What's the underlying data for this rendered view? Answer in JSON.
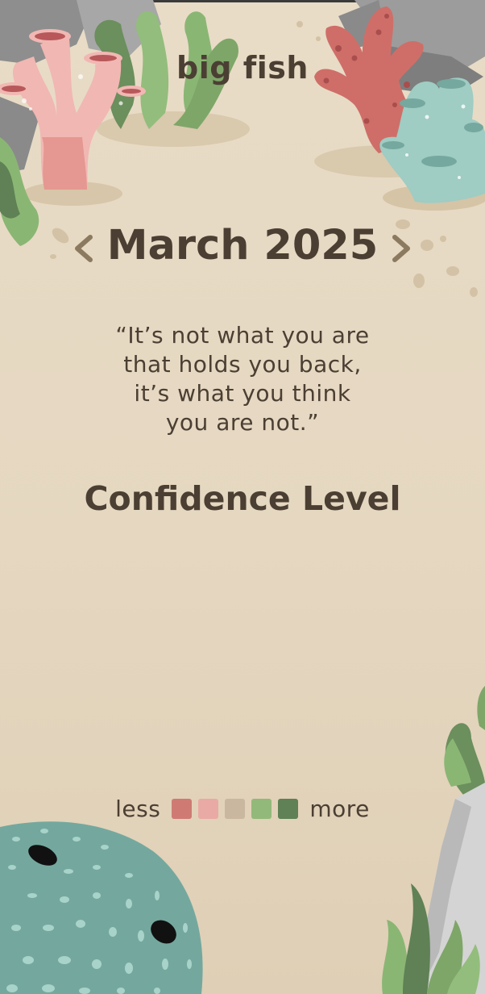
{
  "app": {
    "title": "big fish"
  },
  "month_nav": {
    "month": "March 2025",
    "prev_icon": "chevron-left-icon",
    "next_icon": "chevron-right-icon"
  },
  "quote": {
    "lines": [
      "“It’s not what you are",
      "that holds you back,",
      "it’s what you think",
      "you are not.”"
    ]
  },
  "section": {
    "title": "Confidence Level"
  },
  "legend": {
    "less_label": "less",
    "more_label": "more",
    "colors": [
      "#cf7b74",
      "#e9aaa5",
      "#c9b89f",
      "#93b97a",
      "#5f8155"
    ]
  },
  "palette": {
    "background": "#e6d9c3",
    "text": "#4b3f33",
    "coral_pink": "#f1b7b3",
    "coral_red": "#cf6e68",
    "coral_teal": "#9fccc3",
    "seaweed_green": "#8ab674",
    "seaweed_dark": "#5f8155",
    "rock_gray": "#9a9a9a",
    "fish_teal": "#74a89e"
  }
}
